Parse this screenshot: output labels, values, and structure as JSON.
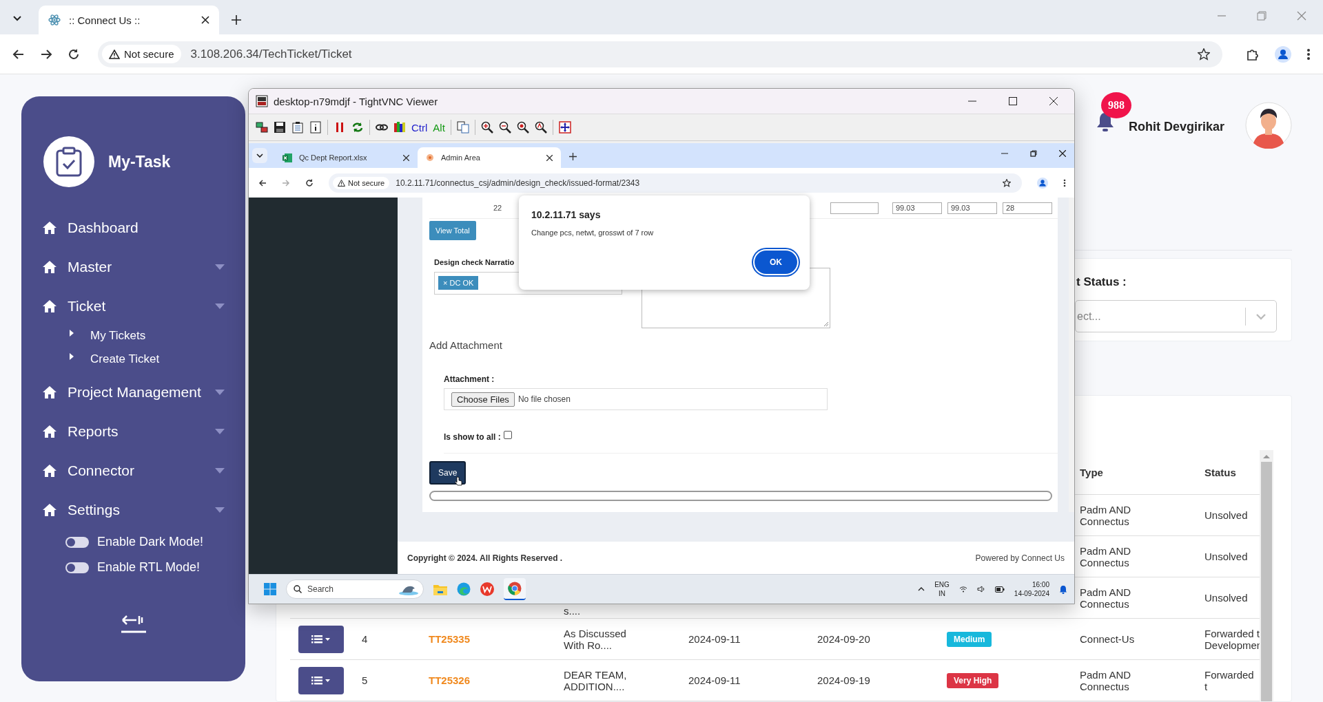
{
  "browser": {
    "tabs": [
      {
        "title": ":: Connect Us ::",
        "selected": true
      }
    ],
    "security": "Not secure",
    "url": "3.108.206.34/TechTicket/Ticket"
  },
  "sidebar": {
    "brand": "My-Task",
    "items": [
      {
        "label": "Dashboard",
        "kind": "link"
      },
      {
        "label": "Master",
        "kind": "dropdown"
      },
      {
        "label": "Ticket",
        "kind": "dropdown",
        "children": [
          {
            "label": "My Tickets"
          },
          {
            "label": "Create Ticket"
          }
        ]
      },
      {
        "label": "Project Management",
        "kind": "dropdown"
      },
      {
        "label": "Reports",
        "kind": "dropdown"
      },
      {
        "label": "Connector",
        "kind": "dropdown"
      },
      {
        "label": "Settings",
        "kind": "dropdown"
      }
    ],
    "toggles": [
      {
        "label": "Enable Dark Mode!",
        "on": false
      },
      {
        "label": "Enable RTL Mode!",
        "on": false
      }
    ]
  },
  "header": {
    "notification_count": "988",
    "user_name": "Rohit Devgirikar"
  },
  "filter": {
    "label": "t Status :",
    "placeholder": "ect..."
  },
  "table": {
    "columns": [
      "Type",
      "Status"
    ],
    "rows": [
      {
        "kind": "partial",
        "type": "Padm AND Connectus",
        "status": "Unsolved"
      },
      {
        "kind": "partial",
        "type": "Padm AND Connectus",
        "status": "Unsolved"
      },
      {
        "kind": "partial",
        "title": "s....",
        "type": "Padm AND Connectus",
        "status": "Unsolved"
      },
      {
        "kind": "full",
        "number": "4",
        "ticket": "TT25335",
        "title": "As Discussed With Ro....",
        "created": "2024-09-11",
        "due": "2024-09-20",
        "priority": {
          "label": "Medium",
          "color": "#17b8dc"
        },
        "type": "Connect-Us",
        "status": "Forwarded t Developmen"
      },
      {
        "kind": "full",
        "number": "5",
        "ticket": "TT25326",
        "title": "DEAR TEAM, ADDITION....",
        "created": "2024-09-11",
        "due": "2024-09-19",
        "priority": {
          "label": "Very High",
          "color": "#dc3545"
        },
        "type": "Padm AND Connectus",
        "status": "Forwarded t"
      }
    ]
  },
  "vnc_window": {
    "title": "desktop-n79mdjf - TightVNC Viewer",
    "toolbar_labels": [
      "Ctrl",
      "Alt"
    ],
    "browser": {
      "tabs": [
        {
          "title": "Qc Dept Report.xlsx",
          "selected": false
        },
        {
          "title": "Admin Area",
          "selected": true
        }
      ],
      "security": "Not secure",
      "url": "10.2.11.71/connectus_csj/admin/design_check/issued-format/2343"
    },
    "form": {
      "grid_cell": "22",
      "grid_inputs": [
        "99.03",
        "99.03",
        "28"
      ],
      "view_total": "View Total",
      "narration_label": "Design check Narratio",
      "tags": [
        {
          "remove": "×",
          "label": "DC OK"
        }
      ],
      "section_title": "Add Attachment",
      "attachment_label": "Attachment :",
      "file_button": "Choose Files",
      "file_status": "No file chosen",
      "show_all_label": "Is show to all :",
      "show_all_checked": false,
      "save": "Save"
    },
    "dialog": {
      "title": "10.2.11.71 says",
      "message": "Change pcs, netwt, grosswt of 7 row",
      "button": "OK"
    },
    "footer": {
      "copyright": "Copyright © 2024. All Rights Reserved .",
      "powered": "Powered by Connect Us"
    },
    "taskbar": {
      "search_placeholder": "Search",
      "language": "ENG",
      "region": "IN",
      "time": "16:00",
      "date": "14-09-2024"
    }
  }
}
